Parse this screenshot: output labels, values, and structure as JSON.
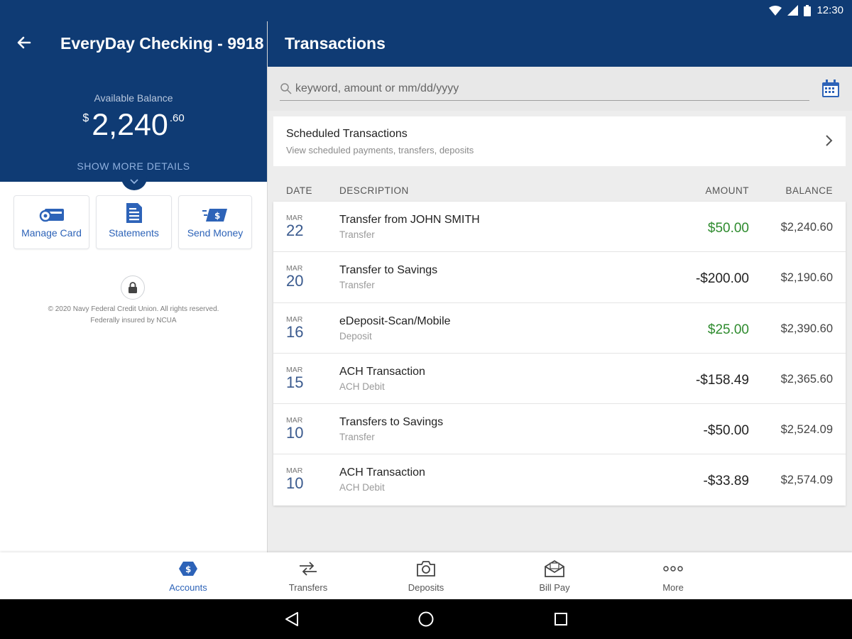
{
  "status": {
    "time": "12:30"
  },
  "account": {
    "title": "EveryDay Checking - 9918",
    "available_label": "Available Balance",
    "currency": "$",
    "balance_main": "2,240",
    "balance_cents": ".60",
    "more_details": "SHOW MORE DETAILS"
  },
  "actions": [
    {
      "label": "Manage Card",
      "icon": "card-icon"
    },
    {
      "label": "Statements",
      "icon": "document-icon"
    },
    {
      "label": "Send Money",
      "icon": "send-money-icon"
    }
  ],
  "legal": {
    "line1": "© 2020 Navy Federal Credit Union. All rights reserved.",
    "line2": "Federally insured by NCUA"
  },
  "transactions": {
    "title": "Transactions",
    "search_placeholder": "keyword, amount or mm/dd/yyyy",
    "scheduled": {
      "title": "Scheduled Transactions",
      "subtitle": "View scheduled payments, transfers, deposits"
    },
    "columns": {
      "date": "DATE",
      "description": "DESCRIPTION",
      "amount": "AMOUNT",
      "balance": "BALANCE"
    },
    "rows": [
      {
        "month": "MAR",
        "day": "22",
        "desc": "Transfer from JOHN SMITH",
        "type": "Transfer",
        "amount": "$50.00",
        "balance": "$2,240.60",
        "positive": true
      },
      {
        "month": "MAR",
        "day": "20",
        "desc": "Transfer to Savings",
        "type": "Transfer",
        "amount": "-$200.00",
        "balance": "$2,190.60",
        "positive": false
      },
      {
        "month": "MAR",
        "day": "16",
        "desc": "eDeposit-Scan/Mobile",
        "type": "Deposit",
        "amount": "$25.00",
        "balance": "$2,390.60",
        "positive": true
      },
      {
        "month": "MAR",
        "day": "15",
        "desc": "ACH Transaction",
        "type": "ACH Debit",
        "amount": "-$158.49",
        "balance": "$2,365.60",
        "positive": false
      },
      {
        "month": "MAR",
        "day": "10",
        "desc": "Transfers to Savings",
        "type": "Transfer",
        "amount": "-$50.00",
        "balance": "$2,524.09",
        "positive": false
      },
      {
        "month": "MAR",
        "day": "10",
        "desc": "ACH Transaction",
        "type": "ACH Debit",
        "amount": "-$33.89",
        "balance": "$2,574.09",
        "positive": false
      }
    ]
  },
  "bottom_nav": [
    {
      "label": "Accounts",
      "icon": "accounts-icon",
      "active": true
    },
    {
      "label": "Transfers",
      "icon": "transfers-icon",
      "active": false
    },
    {
      "label": "Deposits",
      "icon": "camera-icon",
      "active": false
    },
    {
      "label": "Bill Pay",
      "icon": "bill-pay-icon",
      "active": false
    },
    {
      "label": "More",
      "icon": "more-icon",
      "active": false
    }
  ],
  "colors": {
    "primary": "#0f3b74",
    "accent": "#2d63b8",
    "positive": "#2e8b2e"
  }
}
